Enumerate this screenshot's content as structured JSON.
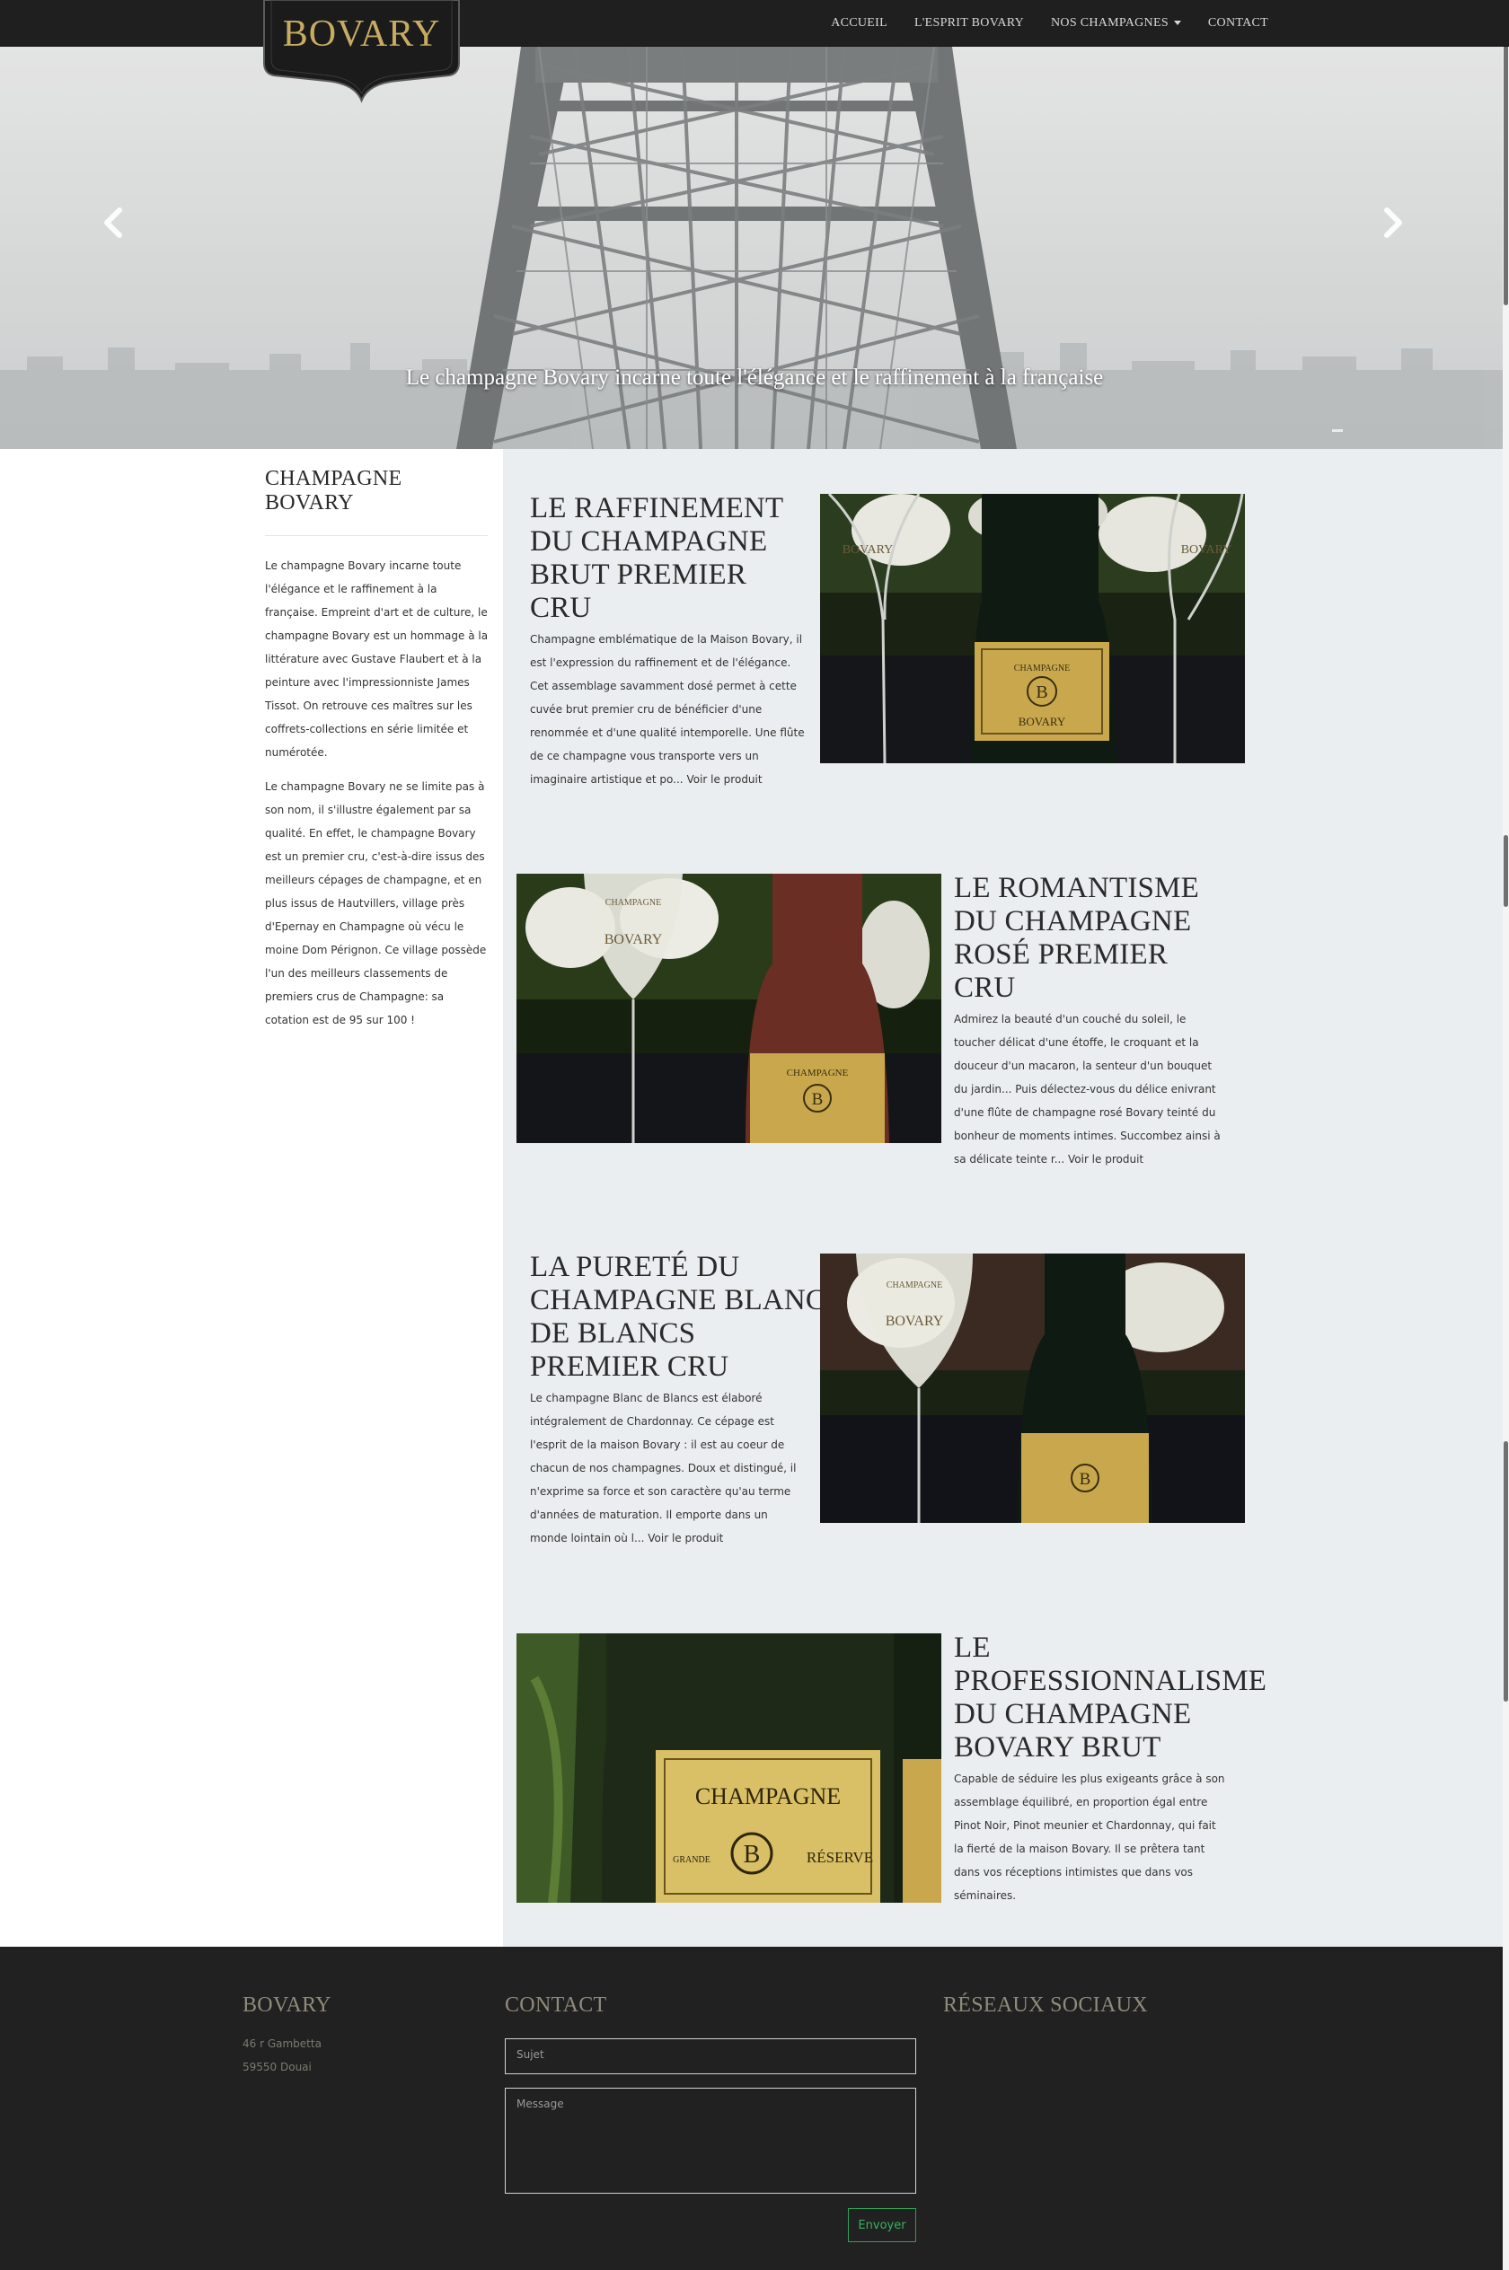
{
  "brand": {
    "logo_text": "BOVARY",
    "gold": "#c8ab63"
  },
  "nav": {
    "items": [
      {
        "label": "ACCUEIL"
      },
      {
        "label": "L'ESPRIT BOVARY"
      },
      {
        "label": "NOS CHAMPAGNES",
        "has_dropdown": true
      },
      {
        "label": "CONTACT"
      }
    ]
  },
  "hero": {
    "caption": "Le champagne Bovary incarne toute l'élégance et le raffinement à la française",
    "prev_icon": "chevron-left-icon",
    "next_icon": "chevron-right-icon"
  },
  "sidebar": {
    "title": "CHAMPAGNE BOVARY",
    "paragraphs": [
      "Le champagne Bovary incarne toute l'élégance et le raffinement à la française. Empreint d'art et de culture, le champagne Bovary est un hommage à la littérature avec Gustave Flaubert et à la peinture avec l'impressionniste James Tissot. On retrouve ces maîtres sur les coffrets-collections en série limitée et numérotée.",
      "Le champagne Bovary ne se limite pas à son nom, il s'illustre également par sa qualité. En effet, le champagne Bovary est un premier cru, c'est-à-dire issus des meilleurs cépages de champagne, et en plus issus de Hautvillers, village près d'Epernay en Champagne où vécu le moine Dom Pérignon. Ce village possède l'un des meilleurs classements de premiers crus de Champagne: sa cotation est de 95 sur 100 !"
    ]
  },
  "products": [
    {
      "title": "LE RAFFINEMENT DU CHAMPAGNE BRUT PREMIER CRU",
      "text": "Champagne emblématique de la Maison Bovary, il est l'expression du raffinement et de l'élégance. Cet assemblage savamment dosé permet à cette cuvée brut premier cru de bénéficier d'une renommée et d'une qualité intemporelle. Une flûte de ce champagne vous transporte vers un imaginaire artistique et po...",
      "read_more": "Voir le produit",
      "image_label": "BOVARY"
    },
    {
      "title": "LE ROMANTISME DU CHAMPAGNE ROSÉ PREMIER CRU",
      "text": "Admirez la beauté d'un couché du soleil, le toucher délicat d'une étoffe, le croquant et la douceur d'un macaron, la senteur d'un bouquet du jardin... Puis délectez-vous du délice enivrant d'une flûte de champagne rosé Bovary teinté du bonheur de moments intimes. Succombez ainsi à sa délicate teinte r...",
      "read_more": "Voir le produit",
      "image_label": "BOVARY"
    },
    {
      "title": "LA PURETÉ DU CHAMPAGNE BLANC DE BLANCS PREMIER CRU",
      "text": "Le champagne Blanc de Blancs est élaboré intégralement de Chardonnay. Ce cépage est l'esprit de la maison Bovary : il est au coeur de chacun de nos champagnes. Doux et distingué, il n'exprime sa force et son caractère qu'au terme d'années de maturation. Il emporte dans un monde lointain où l...",
      "read_more": "Voir le produit",
      "image_label": "BOVARY"
    },
    {
      "title": "LE PROFESSIONNALISME DU CHAMPAGNE BOVARY BRUT",
      "text": "Capable de séduire les plus exigeants grâce à son assemblage équilibré, en proportion égal entre Pinot Noir, Pinot meunier et Chardonnay, qui fait la fierté de la maison Bovary. Il se prêtera tant dans vos réceptions intimistes que dans vos séminaires.",
      "read_more": "",
      "image_label": "CHAMPAGNE",
      "image_label_2": "RÉSERVE",
      "image_label_3": "GRANDE"
    }
  ],
  "footer": {
    "brand_title": "BOVARY",
    "address_line1": "46 r Gambetta",
    "address_line2": "59550 Douai",
    "contact_title": "CONTACT",
    "subject_placeholder": "Sujet",
    "message_placeholder": "Message",
    "submit_label": "Envoyer",
    "social_title": "RÉSEAUX SOCIAUX",
    "submit_color": "#35b35e"
  }
}
